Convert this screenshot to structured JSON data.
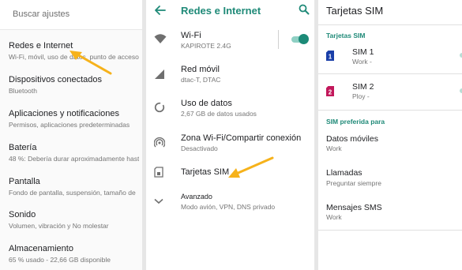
{
  "settings": {
    "search_placeholder": "Buscar ajustes",
    "items": [
      {
        "title": "Redes e Internet",
        "subtitle": "Wi-Fi, móvil, uso de datos, punto de acceso"
      },
      {
        "title": "Dispositivos conectados",
        "subtitle": "Bluetooth"
      },
      {
        "title": "Aplicaciones y notificaciones",
        "subtitle": "Permisos, aplicaciones predeterminadas"
      },
      {
        "title": "Batería",
        "subtitle": "48 %: Debería durar aproximadamente hasta"
      },
      {
        "title": "Pantalla",
        "subtitle": "Fondo de pantalla, suspensión, tamaño de"
      },
      {
        "title": "Sonido",
        "subtitle": "Volumen, vibración y No molestar"
      },
      {
        "title": "Almacenamiento",
        "subtitle": "65 % usado - 22,66 GB disponible"
      }
    ]
  },
  "network": {
    "title": "Redes e Internet",
    "wifi_on": true,
    "items": [
      {
        "title": "Wi-Fi",
        "subtitle": "KAPIROTE 2.4G",
        "icon": "wifi-icon"
      },
      {
        "title": "Red móvil",
        "subtitle": "dtac-T, DTAC",
        "icon": "signal-icon"
      },
      {
        "title": "Uso de datos",
        "subtitle": "2,67 GB de datos usados",
        "icon": "data-usage-icon"
      },
      {
        "title": "Zona Wi-Fi/Compartir conexión",
        "subtitle": "Desactivado",
        "icon": "hotspot-icon"
      },
      {
        "title": "Tarjetas SIM",
        "subtitle": "",
        "icon": "sim-card-icon"
      },
      {
        "title": "Avanzado",
        "subtitle": "Modo avión, VPN, DNS privado",
        "icon": "chevron-down-icon"
      }
    ]
  },
  "sim": {
    "title": "Tarjetas SIM",
    "section1": "Tarjetas SIM",
    "cards": [
      {
        "title": "SIM 1",
        "subtitle": "Work -",
        "badge": "1",
        "color": "#1a3fa8"
      },
      {
        "title": "SIM 2",
        "subtitle": "Ploy -",
        "badge": "2",
        "color": "#c2185b"
      }
    ],
    "section2": "SIM preferida para",
    "prefs": [
      {
        "title": "Datos móviles",
        "subtitle": "Work"
      },
      {
        "title": "Llamadas",
        "subtitle": "Preguntar siempre"
      },
      {
        "title": "Mensajes SMS",
        "subtitle": "Work"
      }
    ]
  },
  "colors": {
    "accent": "#1f8a78",
    "arrow": "#f6b21b"
  }
}
